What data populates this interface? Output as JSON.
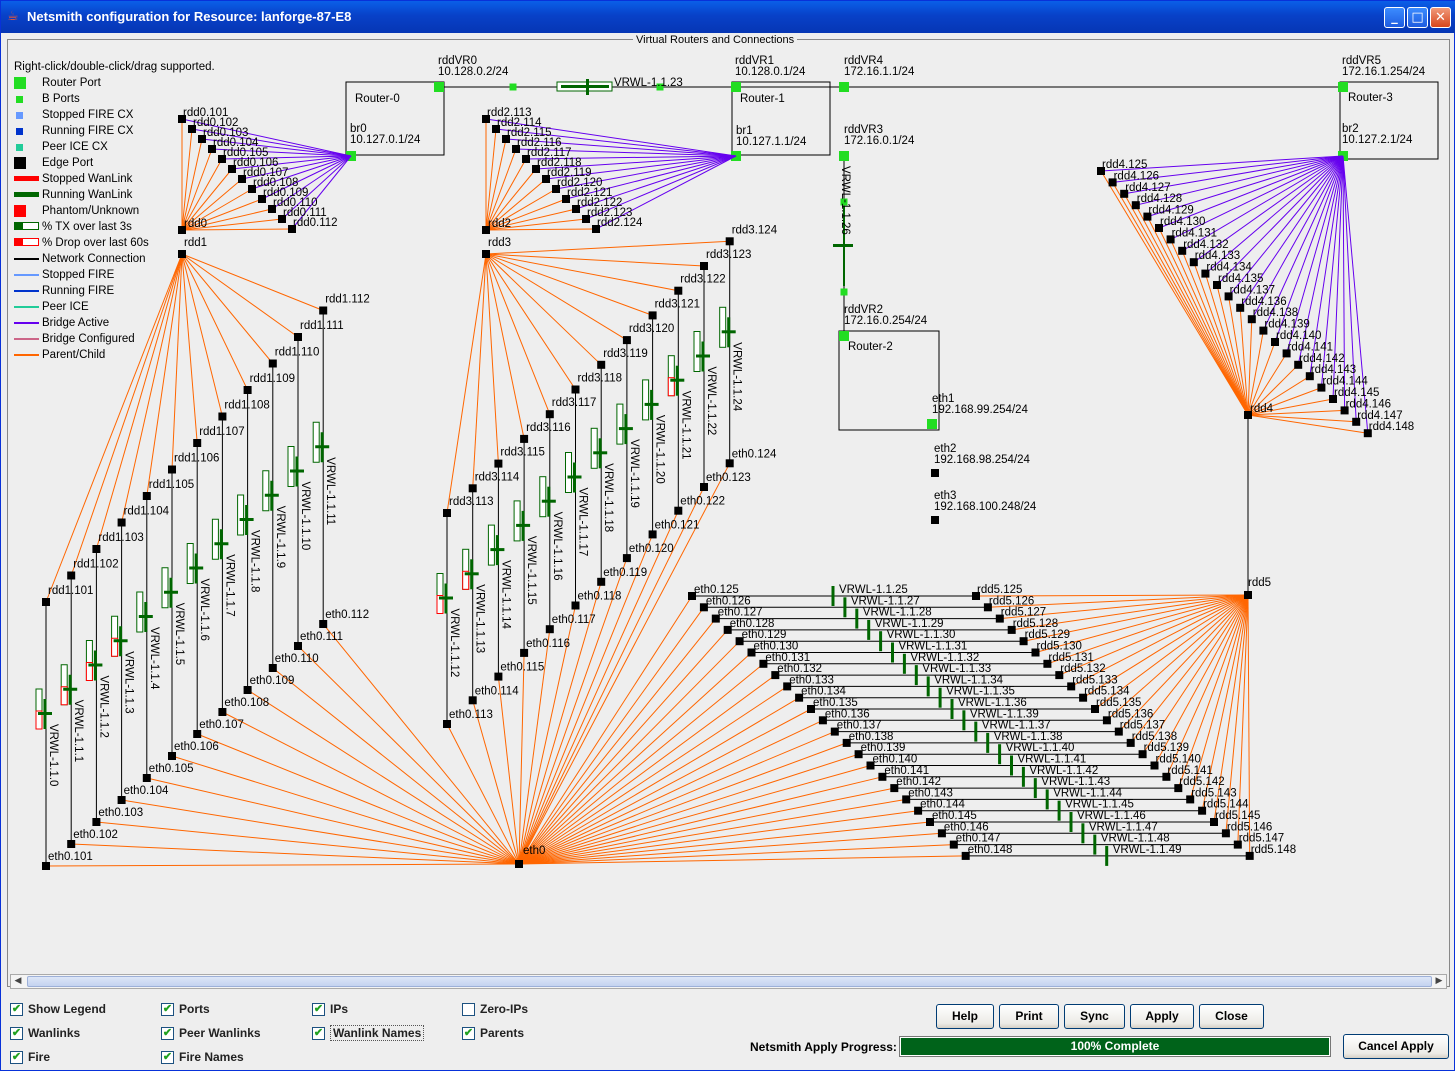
{
  "window": {
    "title": "Netsmith configuration for Resource:  lanforge-87-E8",
    "panel_title": "Virtual Routers and Connections"
  },
  "legend": {
    "hint": "Right-click/double-click/drag supported.",
    "items": [
      {
        "label": "Router Port",
        "kind": "sq",
        "color": "#22dd22"
      },
      {
        "label": "B Ports",
        "kind": "sqs",
        "color": "#22dd22"
      },
      {
        "label": "Stopped FIRE CX",
        "kind": "sqs",
        "color": "#6699ff"
      },
      {
        "label": "Running FIRE CX",
        "kind": "sqs",
        "color": "#0033cc"
      },
      {
        "label": "Peer ICE CX",
        "kind": "sqs",
        "color": "#22cc99"
      },
      {
        "label": "Edge Port",
        "kind": "sq",
        "color": "#000000"
      },
      {
        "label": "Stopped WanLink",
        "kind": "bar",
        "color": "#ff0000"
      },
      {
        "label": "Running WanLink",
        "kind": "bar",
        "color": "#006600"
      },
      {
        "label": "Phantom/Unknown",
        "kind": "sq",
        "color": "#ff0000"
      },
      {
        "label": "% TX over last 3s",
        "kind": "tx",
        "color": "#006600"
      },
      {
        "label": "% Drop over last 60s",
        "kind": "drop",
        "color": "#ff0000"
      },
      {
        "label": "Network Connection",
        "kind": "line",
        "color": "#000000"
      },
      {
        "label": "Stopped FIRE",
        "kind": "line",
        "color": "#6699ff"
      },
      {
        "label": "Running FIRE",
        "kind": "line",
        "color": "#0033cc"
      },
      {
        "label": "Peer ICE",
        "kind": "line",
        "color": "#22cc99"
      },
      {
        "label": "Bridge Active",
        "kind": "line",
        "color": "#6600ee"
      },
      {
        "label": "Bridge Configured",
        "kind": "line",
        "color": "#cc6688"
      },
      {
        "label": "Parent/Child",
        "kind": "line",
        "color": "#ff6600"
      }
    ]
  },
  "routers": [
    {
      "name": "Router-0"
    },
    {
      "name": "Router-1"
    },
    {
      "name": "Router-2"
    },
    {
      "name": "Router-3"
    }
  ],
  "ports": [
    {
      "name": "rddVR0",
      "ip": "10.128.0.2/24"
    },
    {
      "name": "rddVR1",
      "ip": "10.128.0.1/24"
    },
    {
      "name": "rddVR4",
      "ip": "172.16.1.1/24"
    },
    {
      "name": "rddVR5",
      "ip": "172.16.1.254/24"
    },
    {
      "name": "rddVR3",
      "ip": "172.16.0.1/24"
    },
    {
      "name": "rddVR2",
      "ip": "172.16.0.254/24"
    },
    {
      "name": "br0",
      "ip": "10.127.0.1/24"
    },
    {
      "name": "br1",
      "ip": "10.127.1.1/24"
    },
    {
      "name": "br2",
      "ip": "10.127.2.1/24"
    },
    {
      "name": "eth1",
      "ip": "192.168.99.254/24"
    },
    {
      "name": "eth2",
      "ip": "192.168.98.254/24"
    },
    {
      "name": "eth3",
      "ip": "192.168.100.248/24"
    }
  ],
  "router_wanlinks": [
    "VRWL-1.1.23",
    "VRWL-1.1.26"
  ],
  "groups": {
    "rdd0": {
      "parent": "rdd0",
      "children": [
        "rdd0.101",
        "rdd0.102",
        "rdd0.103",
        "rdd0.104",
        "rdd0.105",
        "rdd0.106",
        "rdd0.107",
        "rdd0.108",
        "rdd0.109",
        "rdd0.110",
        "rdd0.111",
        "rdd0.112"
      ]
    },
    "rdd2": {
      "parent": "rdd2",
      "children": [
        "rdd2.113",
        "rdd2.114",
        "rdd2.115",
        "rdd2.116",
        "rdd2.117",
        "rdd2.118",
        "rdd2.119",
        "rdd2.120",
        "rdd2.121",
        "rdd2.122",
        "rdd2.123",
        "rdd2.124"
      ]
    },
    "rdd4": {
      "parent": "rdd4",
      "children": [
        "rdd4.125",
        "rdd4.126",
        "rdd4.127",
        "rdd4.128",
        "rdd4.129",
        "rdd4.130",
        "rdd4.131",
        "rdd4.132",
        "rdd4.133",
        "rdd4.134",
        "rdd4.135",
        "rdd4.137",
        "rdd4.136",
        "rdd4.138",
        "rdd4.139",
        "rdd4.140",
        "rdd4.141",
        "rdd4.142",
        "rdd4.143",
        "rdd4.144",
        "rdd4.145",
        "rdd4.146",
        "rdd4.147",
        "rdd4.148"
      ]
    }
  },
  "pairs_a": {
    "parent": "rdd1",
    "rdd": [
      "rdd1.101",
      "rdd1.102",
      "rdd1.103",
      "rdd1.104",
      "rdd1.105",
      "rdd1.106",
      "rdd1.107",
      "rdd1.108",
      "rdd1.109",
      "rdd1.110",
      "rdd1.111",
      "rdd1.112"
    ],
    "eth": [
      "eth0.101",
      "eth0.102",
      "eth0.103",
      "eth0.104",
      "eth0.105",
      "eth0.106",
      "eth0.107",
      "eth0.108",
      "eth0.109",
      "eth0.110",
      "eth0.111",
      "eth0.112"
    ],
    "wl": [
      "VRWL-1.1.0",
      "VRWL-1.1.1",
      "VRWL-1.1.2",
      "VRWL-1.1.3",
      "VRWL-1.1.4",
      "VRWL-1.1.5",
      "VRWL-1.1.6",
      "VRWL-1.1.7",
      "VRWL-1.1.8",
      "VRWL-1.1.9",
      "VRWL-1.1.10",
      "VRWL-1.1.11"
    ]
  },
  "pairs_b": {
    "parent": "rdd3",
    "rdd": [
      "rdd3.113",
      "rdd3.114",
      "rdd3.115",
      "rdd3.116",
      "rdd3.117",
      "rdd3.118",
      "rdd3.119",
      "rdd3.120",
      "rdd3.121",
      "rdd3.122",
      "rdd3.123",
      "rdd3.124"
    ],
    "eth": [
      "eth0.113",
      "eth0.114",
      "eth0.115",
      "eth0.116",
      "eth0.117",
      "eth0.118",
      "eth0.119",
      "eth0.120",
      "eth0.121",
      "eth0.122",
      "eth0.123",
      "eth0.124"
    ],
    "wl": [
      "VRWL-1.1.12",
      "VRWL-1.1.13",
      "VRWL-1.1.14",
      "VRWL-1.1.15",
      "VRWL-1.1.16",
      "VRWL-1.1.17",
      "VRWL-1.1.18",
      "VRWL-1.1.19",
      "VRWL-1.1.20",
      "VRWL-1.1.21",
      "VRWL-1.1.22",
      "VRWL-1.1.24"
    ]
  },
  "pairs_c": {
    "parent": "rdd5",
    "eth": [
      "eth0.125",
      "eth0.126",
      "eth0.127",
      "eth0.128",
      "eth0.129",
      "eth0.130",
      "eth0.131",
      "eth0.132",
      "eth0.133",
      "eth0.134",
      "eth0.135",
      "eth0.136",
      "eth0.137",
      "eth0.138",
      "eth0.139",
      "eth0.140",
      "eth0.141",
      "eth0.142",
      "eth0.143",
      "eth0.144",
      "eth0.145",
      "eth0.146",
      "eth0.147",
      "eth0.148"
    ],
    "rdd": [
      "rdd5.125",
      "rdd5.126",
      "rdd5.127",
      "rdd5.128",
      "rdd5.129",
      "rdd5.130",
      "rdd5.131",
      "rdd5.132",
      "rdd5.133",
      "rdd5.134",
      "rdd5.135",
      "rdd5.136",
      "rdd5.137",
      "rdd5.138",
      "rdd5.139",
      "rdd5.140",
      "rdd5.141",
      "rdd5.142",
      "rdd5.143",
      "rdd5.144",
      "rdd5.145",
      "rdd5.146",
      "rdd5.147",
      "rdd5.148"
    ],
    "wl": [
      "VRWL-1.1.25",
      "VRWL-1.1.27",
      "VRWL-1.1.28",
      "VRWL-1.1.29",
      "VRWL-1.1.30",
      "VRWL-1.1.31",
      "VRWL-1.1.32",
      "VRWL-1.1.33",
      "VRWL-1.1.34",
      "VRWL-1.1.35",
      "VRWL-1.1.36",
      "VRWL-1.1.39",
      "VRWL-1.1.37",
      "VRWL-1.1.38",
      "VRWL-1.1.40",
      "VRWL-1.1.41",
      "VRWL-1.1.42",
      "VRWL-1.1.43",
      "VRWL-1.1.44",
      "VRWL-1.1.45",
      "VRWL-1.1.46",
      "VRWL-1.1.47",
      "VRWL-1.1.48",
      "VRWL-1.1.49"
    ]
  },
  "eth0": "eth0",
  "checkboxes": [
    {
      "label": "Show Legend",
      "checked": true
    },
    {
      "label": "Ports",
      "checked": true
    },
    {
      "label": "IPs",
      "checked": true
    },
    {
      "label": "Zero-IPs",
      "checked": false
    },
    {
      "label": "Wanlinks",
      "checked": true
    },
    {
      "label": "Peer Wanlinks",
      "checked": true
    },
    {
      "label": "Wanlink Names",
      "checked": true
    },
    {
      "label": "Parents",
      "checked": true
    },
    {
      "label": "Fire",
      "checked": true
    },
    {
      "label": "Fire Names",
      "checked": true
    }
  ],
  "buttons": {
    "help": "Help",
    "print": "Print",
    "sync": "Sync",
    "apply": "Apply",
    "close": "Close",
    "cancel_apply": "Cancel Apply"
  },
  "progress": {
    "label": "Netsmith Apply Progress:",
    "value": 1.0,
    "text": "100% Complete",
    "color": "#00631a"
  },
  "colors": {
    "parent_child": "#ff6600",
    "bridge": "#6600ee",
    "port": "#22dd22",
    "wanlink": "#006600",
    "drop": "#ff0000"
  }
}
